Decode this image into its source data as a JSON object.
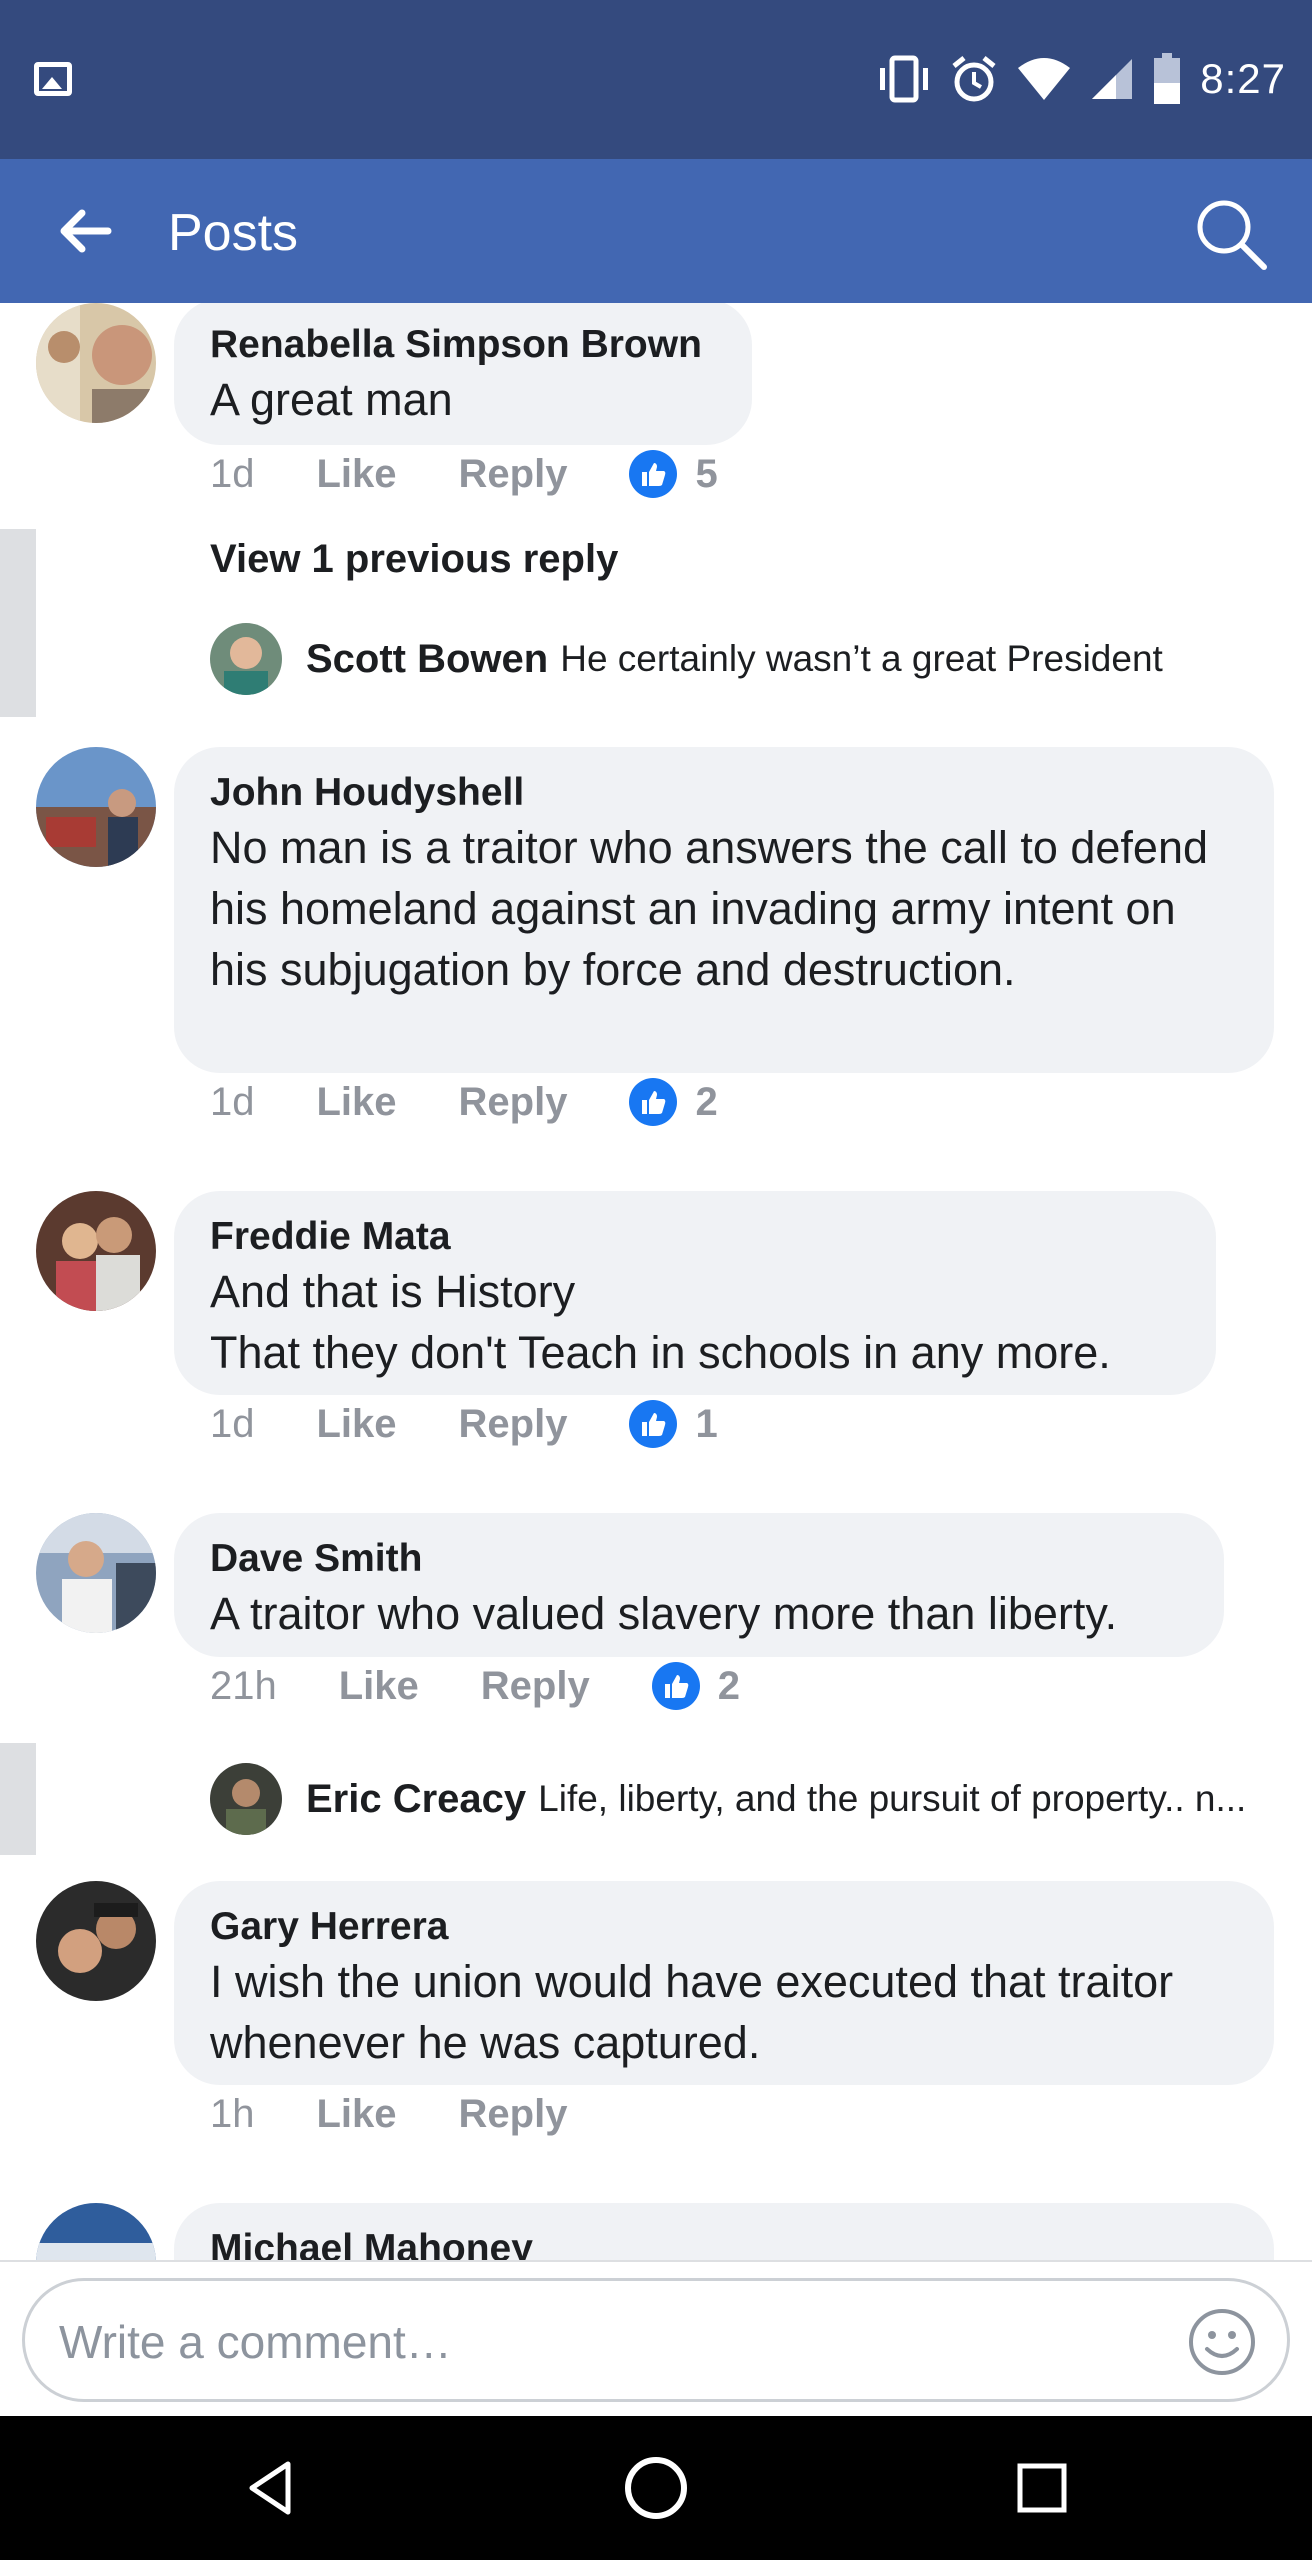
{
  "status_bar": {
    "time": "8:27"
  },
  "app_bar": {
    "title": "Posts"
  },
  "comments": [
    {
      "name": "Renabella Simpson Brown",
      "text": "A great man",
      "time": "1d",
      "like": "Like",
      "reply": "Reply",
      "reactions": "5"
    },
    {
      "name": "John Houdyshell",
      "text": "No man is a traitor who answers the call to defend his homeland against an invading army intent on his subjugation by force and destruction.",
      "time": "1d",
      "like": "Like",
      "reply": "Reply",
      "reactions": "2"
    },
    {
      "name": "Freddie Mata",
      "text": "And that is History\nThat they don't Teach in schools in any more.",
      "time": "1d",
      "like": "Like",
      "reply": "Reply",
      "reactions": "1"
    },
    {
      "name": "Dave Smith",
      "text": "A traitor who valued slavery more than liberty.",
      "time": "21h",
      "like": "Like",
      "reply": "Reply",
      "reactions": "2"
    },
    {
      "name": "Gary Herrera",
      "text": "I wish the union would have executed that traitor whenever he was captured.",
      "time": "1h",
      "like": "Like",
      "reply": "Reply"
    },
    {
      "name": "Michael Mahoney"
    }
  ],
  "thread_1": {
    "view_previous": "View 1 previous reply",
    "reply": {
      "name": "Scott Bowen",
      "text": "He certainly wasn’t a great President"
    }
  },
  "thread_2": {
    "reply": {
      "name": "Eric Creacy",
      "text": "Life, liberty, and the pursuit of property.. n..."
    }
  },
  "composer": {
    "placeholder": "Write a comment…"
  },
  "colors": {
    "status_bar": "#344a7e",
    "app_bar": "#4267b2",
    "like_blue": "#1877f2",
    "bubble": "#f0f2f5"
  }
}
